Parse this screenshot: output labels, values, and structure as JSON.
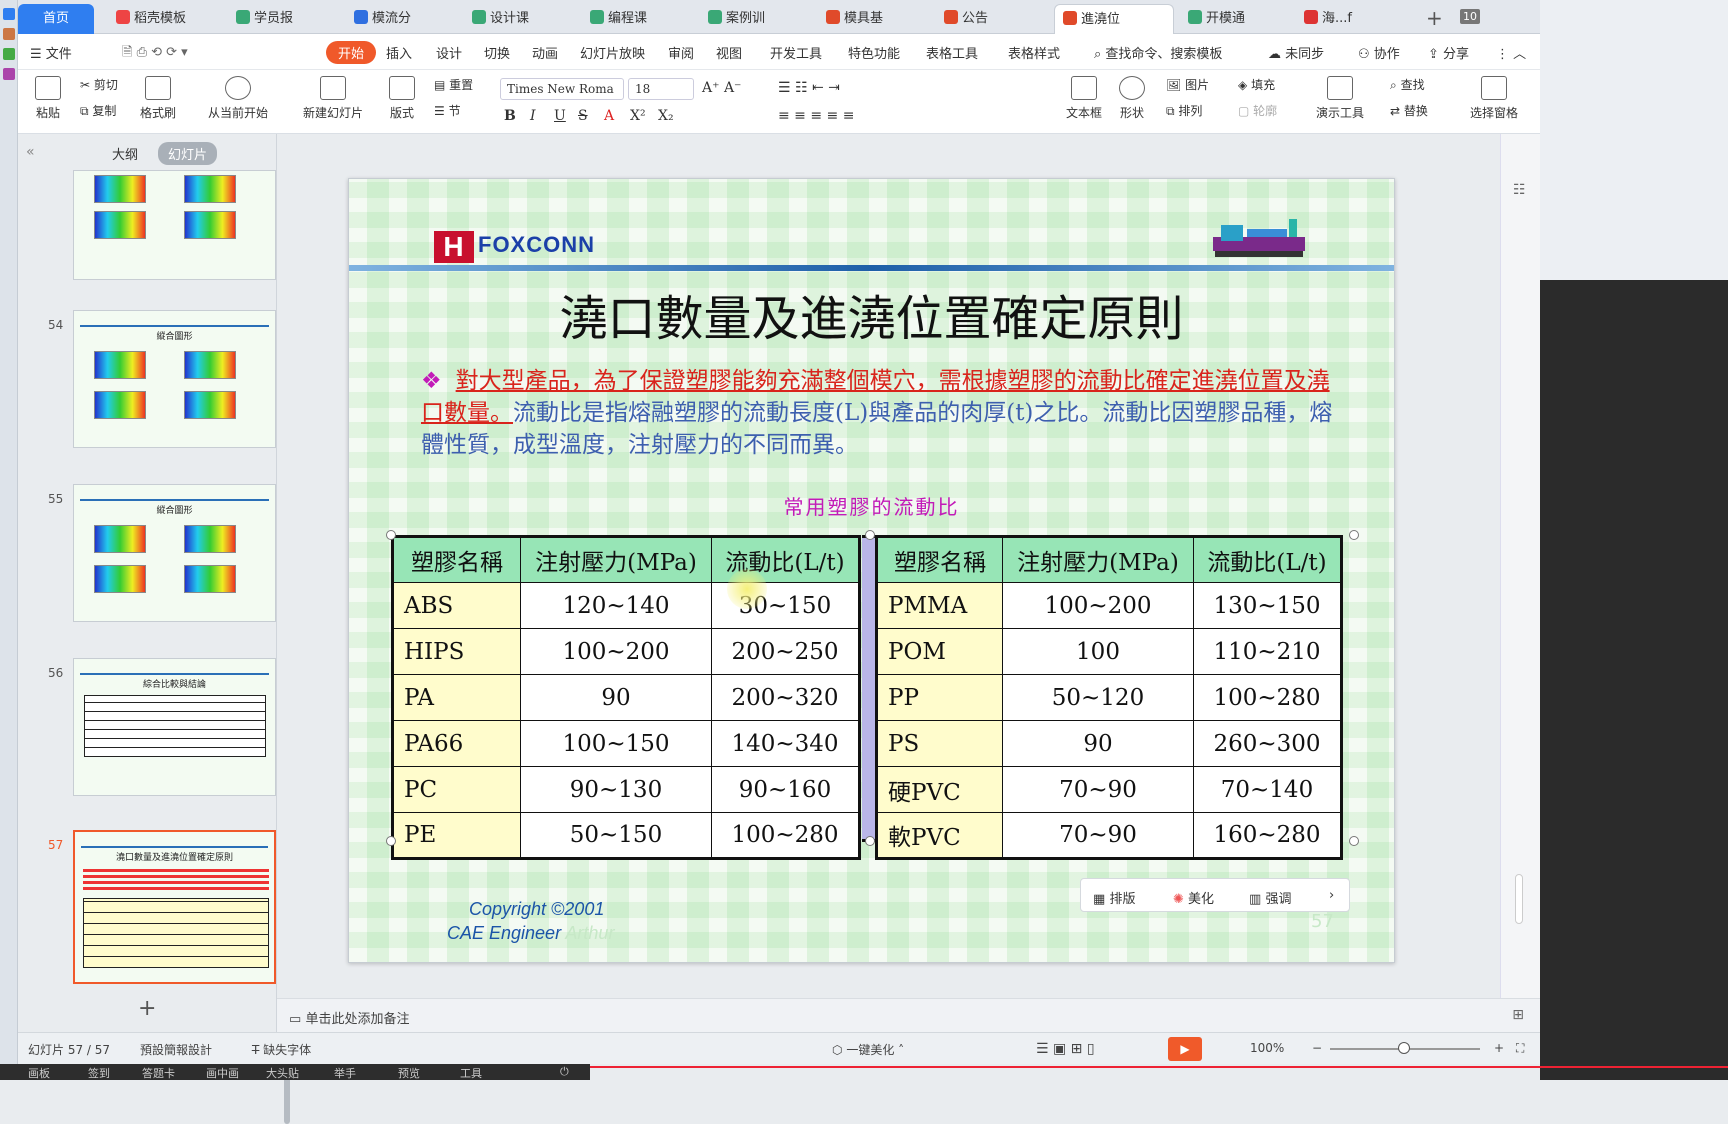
{
  "tabs": {
    "home": "首页",
    "items": [
      "稻壳模板",
      "学员报",
      "模流分",
      "设计课",
      "编程课",
      "案例训",
      "模具基",
      "公告",
      "進澆位",
      "开模通",
      "海...f"
    ],
    "count": "10"
  },
  "menu": {
    "file": "文件",
    "items": [
      "开始",
      "插入",
      "设计",
      "切换",
      "动画",
      "幻灯片放映",
      "审阅",
      "视图",
      "开发工具",
      "特色功能",
      "表格工具",
      "表格样式"
    ],
    "search": "查找命令、搜索模板",
    "sync": "未同步",
    "collab": "协作",
    "share": "分享"
  },
  "ribbon": {
    "paste": "粘贴",
    "cut": "剪切",
    "copy": "复制",
    "format_painter": "格式刷",
    "play_from_current": "从当前开始",
    "new_slide": "新建幻灯片",
    "layout": "版式",
    "reset": "重置",
    "section": "节",
    "font_name": "Times New Roma",
    "font_size": "18",
    "textbox": "文本框",
    "shape": "形状",
    "arrange": "排列",
    "picture": "图片",
    "fill": "填充",
    "outline": "轮廓",
    "present_tools": "演示工具",
    "find": "查找",
    "replace": "替换",
    "select_pane": "选择窗格"
  },
  "left_panel": {
    "tab_outline": "大纲",
    "tab_slides": "幻灯片",
    "slides": [
      {
        "num": "54",
        "title": "縱合圖形"
      },
      {
        "num": "55",
        "title": "縱合圖形"
      },
      {
        "num": "56",
        "title": "綜合比較與結論"
      },
      {
        "num": "57",
        "title": "澆口數量及進澆位置確定原則"
      }
    ]
  },
  "slide": {
    "logo_text": "FOXCONN",
    "title": "澆口數量及進澆位置確定原則",
    "bullet": "❖",
    "para_red": "對大型產品，為了保證塑膠能夠充滿整個模穴，需根據塑膠的流動比確定進澆位置及澆口數量。",
    "para_blue": "流動比是指熔融塑膠的流動長度(L)與產品的肉厚(t)之比。流動比因塑膠品種，熔體性質，成型溫度，注射壓力的不同而異。",
    "table_title": "常用塑膠的流動比",
    "headers": [
      "塑膠名稱",
      "注射壓力(MPa)",
      "流動比(L/t)"
    ],
    "left_rows": [
      [
        "ABS",
        "120~140",
        "30~150"
      ],
      [
        "HIPS",
        "100~200",
        "200~250"
      ],
      [
        "PA",
        "90",
        "200~320"
      ],
      [
        "PA66",
        "100~150",
        "140~340"
      ],
      [
        "PC",
        "90~130",
        "90~160"
      ],
      [
        "PE",
        "50~150",
        "100~280"
      ]
    ],
    "right_rows": [
      [
        "PMMA",
        "100~200",
        "130~150"
      ],
      [
        "POM",
        "100",
        "110~210"
      ],
      [
        "PP",
        "50~120",
        "100~280"
      ],
      [
        "PS",
        "90",
        "260~300"
      ],
      [
        "硬PVC",
        "70~90",
        "70~140"
      ],
      [
        "軟PVC",
        "70~90",
        "160~280"
      ]
    ],
    "copyright": "Copyright ©2001",
    "engineer": "CAE Engineer",
    "engineer_name": "Arthur",
    "slide_num": "57"
  },
  "float_toolbar": {
    "layout": "排版",
    "beautify": "美化",
    "emphasize": "强调"
  },
  "notes_placeholder": "单击此处添加备注",
  "status": {
    "slide_count": "幻灯片 57 / 57",
    "theme": "預設簡報設計",
    "missing_font": "缺失字体",
    "beautify": "一键美化",
    "zoom": "100%"
  },
  "taskbar": [
    "画板",
    "签到",
    "答题卡",
    "画中画",
    "大头贴",
    "举手",
    "预览",
    "工具"
  ]
}
